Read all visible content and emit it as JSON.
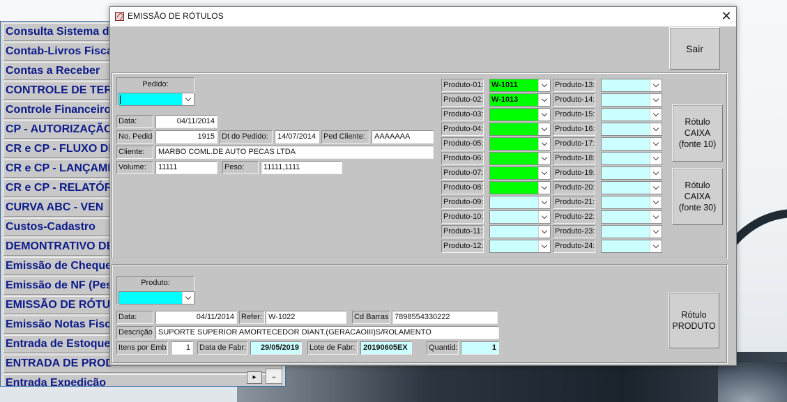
{
  "background_list": {
    "items": [
      "Consulta Sistema de",
      "Contab-Livros Fisca",
      "Contas a Receber",
      "CONTROLE DE TER",
      "Controle Financeiro",
      "CP - AUTORIZAÇÃO",
      "CR e CP - FLUXO DI",
      "CR e CP - LANÇAME",
      "CR e CP - RELATÓR",
      "CURVA ABC  -  VEN",
      "Custos-Cadastro",
      "DEMONTRATIVO DE",
      "Emissão de Cheque",
      "Emissão de NF (Pes",
      "EMISSÃO DE RÓTU",
      "Emissão Notas Fisc",
      "Entrada de Estoque",
      "ENTRADA DE PROD",
      "Entrada Expedição"
    ],
    "scroll_right": "▸",
    "dropdown_glyph": "⌄"
  },
  "window": {
    "title": "EMISSÃO DE RÓTULOS",
    "close_glyph": "✕",
    "icon": "app-icon"
  },
  "buttons": {
    "sair": "Sair",
    "rotulo_caixa_10": "Rótulo\nCAIXA\n(fonte 10)",
    "rotulo_caixa_30": "Rótulo\nCAIXA\n(fonte 30)",
    "rotulo_produto": "Rótulo\nPRODUTO"
  },
  "pedido": {
    "group_label": "Pedido:",
    "data_label": "Data:",
    "data_value": "04/11/2014",
    "no_pedido_label": "No. Pedido",
    "no_pedido_value": "1915",
    "dt_pedido_label": "Dt do Pedido:",
    "dt_pedido_value": "14/07/2014",
    "ped_cliente_label": "Ped Cliente:",
    "ped_cliente_value": "AAAAAAA",
    "cliente_label": "Cliente:",
    "cliente_value": "MARBO COML.DE AUTO PECAS LTDA",
    "volume_label": "Volume:",
    "volume_value": "11111",
    "peso_label": "Peso:",
    "peso_value": "11111,1111"
  },
  "produtos_left": [
    {
      "label": "Produto-01:",
      "value": "W-1011",
      "color": "green"
    },
    {
      "label": "Produto-02:",
      "value": "W-1013",
      "color": "green"
    },
    {
      "label": "Produto-03:",
      "value": "",
      "color": "green"
    },
    {
      "label": "Produto-04:",
      "value": "",
      "color": "green"
    },
    {
      "label": "Produto-05:",
      "value": "",
      "color": "green"
    },
    {
      "label": "Produto-06:",
      "value": "",
      "color": "green"
    },
    {
      "label": "Produto-07:",
      "value": "",
      "color": "green"
    },
    {
      "label": "Produto-08:",
      "value": "",
      "color": "green"
    },
    {
      "label": "Produto-09:",
      "value": "",
      "color": "cyan"
    },
    {
      "label": "Produto-10:",
      "value": "",
      "color": "cyan"
    },
    {
      "label": "Produto-11:",
      "value": "",
      "color": "cyan"
    },
    {
      "label": "Produto-12:",
      "value": "",
      "color": "cyan"
    }
  ],
  "produtos_right": [
    {
      "label": "Produto-13:",
      "value": ""
    },
    {
      "label": "Produto-14:",
      "value": ""
    },
    {
      "label": "Produto-15:",
      "value": ""
    },
    {
      "label": "Produto-16:",
      "value": ""
    },
    {
      "label": "Produto-17:",
      "value": ""
    },
    {
      "label": "Produto-18:",
      "value": ""
    },
    {
      "label": "Produto-19:",
      "value": ""
    },
    {
      "label": "Produto-20:",
      "value": ""
    },
    {
      "label": "Produto-21:",
      "value": ""
    },
    {
      "label": "Produto-22:",
      "value": ""
    },
    {
      "label": "Produto-23:",
      "value": ""
    },
    {
      "label": "Produto-24:",
      "value": ""
    }
  ],
  "produto": {
    "group_label": "Produto:",
    "data_label": "Data:",
    "data_value": "04/11/2014",
    "refer_label": "Refer:",
    "refer_value": "W-1022",
    "cd_barras_label": "Cd Barras",
    "cd_barras_value": "7898554330222",
    "descricao_label": "Descrição",
    "descricao_value": "SUPORTE SUPERIOR AMORTECEDOR DIANT.(GERACAOIII)S/ROLAMENTO",
    "itens_por_emb_label": "Itens por Emb:",
    "itens_por_emb_value": "1",
    "data_fabr_label": "Data de Fabr:",
    "data_fabr_value": "29/05/2019",
    "lote_fabr_label": "Lote de Fabr:",
    "lote_fabr_value": "20190605EX",
    "quantid_label": "Quantid:",
    "quantid_value": "1"
  },
  "colors": {
    "green_field": "#00ff00",
    "cyan_field": "#ccffff",
    "cyan_selected": "#00ffff",
    "list_text": "#0d1b8a",
    "dialog_bg": "#c4c4c4"
  }
}
